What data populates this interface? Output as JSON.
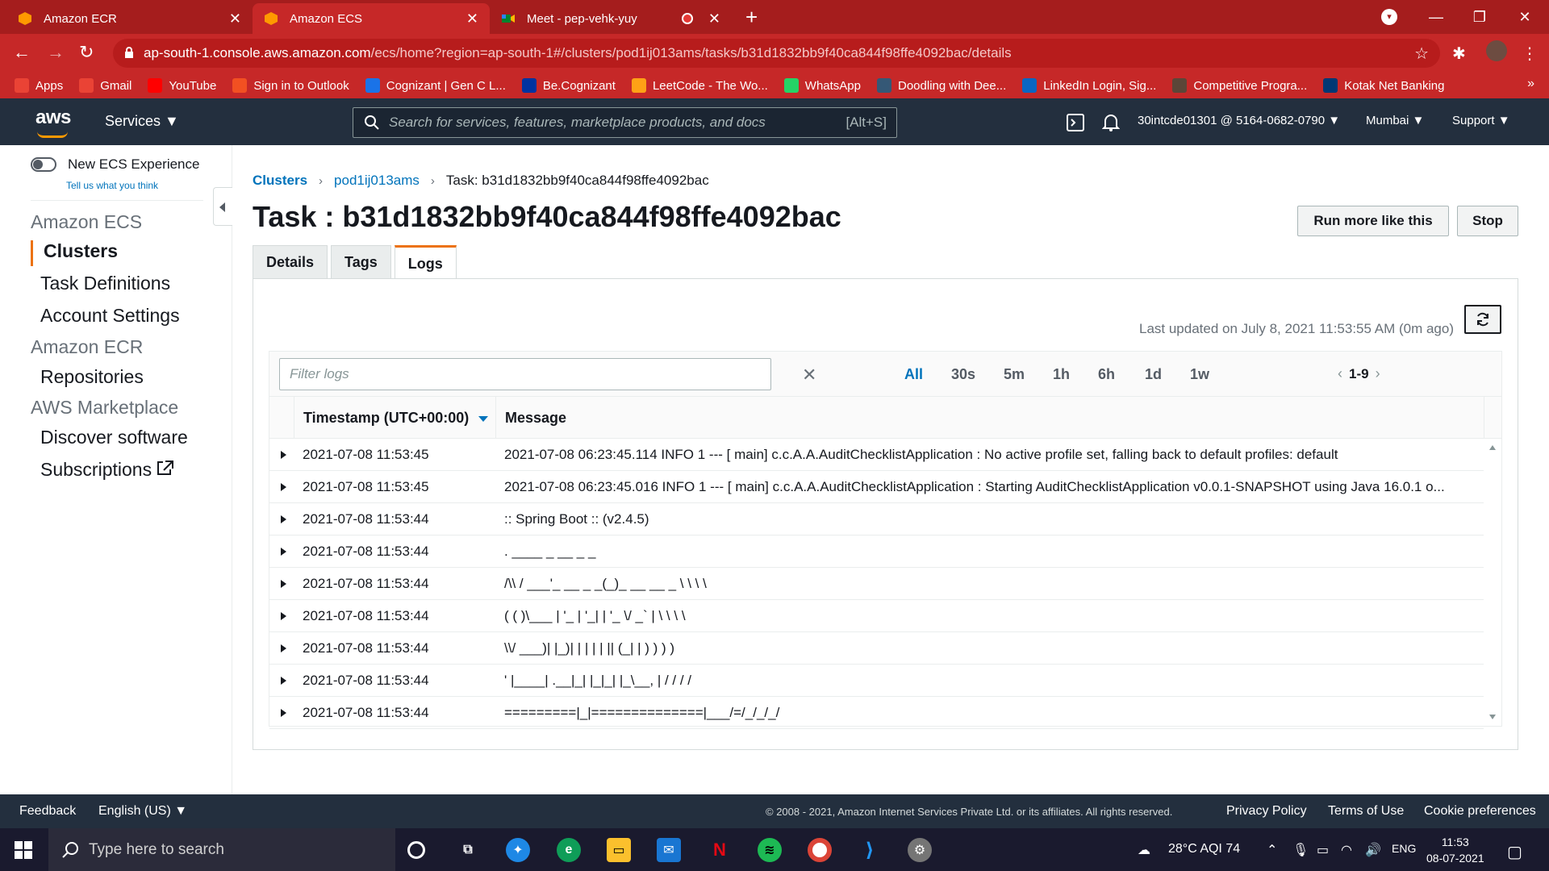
{
  "browser": {
    "tabs": [
      {
        "title": "Amazon ECR",
        "active": false
      },
      {
        "title": "Amazon ECS",
        "active": true
      },
      {
        "title": "Meet - pep-vehk-yuy",
        "active": false
      }
    ],
    "url_host": "ap-south-1.console.aws.amazon.com",
    "url_path": "/ecs/home?region=ap-south-1#/clusters/pod1ij013ams/tasks/b31d1832bb9f40ca844f98ffe4092bac/details",
    "bookmarks": [
      {
        "label": "Apps",
        "icon": "apps-grid-icon",
        "color": "#ea4335"
      },
      {
        "label": "Gmail",
        "icon": "gmail-icon",
        "color": "#ea4335"
      },
      {
        "label": "YouTube",
        "icon": "youtube-icon",
        "color": "#ff0000"
      },
      {
        "label": "Sign in to Outlook",
        "icon": "microsoft-icon",
        "color": "#f25022"
      },
      {
        "label": "Cognizant | Gen C L...",
        "icon": "cognizant-icon",
        "color": "#1a73e8"
      },
      {
        "label": "Be.Cognizant",
        "icon": "becognizant-icon",
        "color": "#0033a0"
      },
      {
        "label": "LeetCode - The Wo...",
        "icon": "leetcode-icon",
        "color": "#ffa116"
      },
      {
        "label": "WhatsApp",
        "icon": "whatsapp-icon",
        "color": "#25d366"
      },
      {
        "label": "Doodling with Dee...",
        "icon": "tds-icon",
        "color": "#355876"
      },
      {
        "label": "LinkedIn Login, Sig...",
        "icon": "linkedin-icon",
        "color": "#0a66c2"
      },
      {
        "label": "Competitive Progra...",
        "icon": "cc-icon",
        "color": "#5b4638"
      },
      {
        "label": "Kotak Net Banking",
        "icon": "kotak-icon",
        "color": "#003874"
      }
    ],
    "bookmarks_more": "»"
  },
  "aws_nav": {
    "logo": "aws",
    "services": "Services",
    "search_placeholder": "Search for services, features, marketplace products, and docs",
    "search_hint": "[Alt+S]",
    "account": "30intcde01301 @ 5164-0682-0790",
    "region": "Mumbai",
    "support": "Support"
  },
  "sidebar": {
    "toggle_label": "New ECS Experience",
    "feedback_link": "Tell us what you think",
    "sections": [
      {
        "heading": "Amazon ECS",
        "items": [
          "Clusters",
          "Task Definitions",
          "Account Settings"
        ]
      },
      {
        "heading": "Amazon ECR",
        "items": [
          "Repositories"
        ]
      },
      {
        "heading": "AWS Marketplace",
        "items": [
          "Discover software",
          "Subscriptions"
        ]
      }
    ],
    "active_item": "Clusters"
  },
  "breadcrumb": {
    "items": [
      "Clusters",
      "pod1ij013ams"
    ],
    "current": "Task: b31d1832bb9f40ca844f98ffe4092bac"
  },
  "page": {
    "title": "Task : b31d1832bb9f40ca844f98ffe4092bac",
    "run_more_label": "Run more like this",
    "stop_label": "Stop",
    "tabs": [
      "Details",
      "Tags",
      "Logs"
    ],
    "active_tab": "Logs"
  },
  "logs": {
    "last_updated": "Last updated on July 8, 2021 11:53:55 AM (0m ago)",
    "filter_placeholder": "Filter logs",
    "ranges": [
      "All",
      "30s",
      "5m",
      "1h",
      "6h",
      "1d",
      "1w"
    ],
    "active_range": "All",
    "pager": "1-9",
    "columns": [
      "Timestamp (UTC+00:00)",
      "Message"
    ],
    "rows": [
      {
        "timestamp": "2021-07-08 11:53:45",
        "message": "2021-07-08 06:23:45.114 INFO 1 --- [ main] c.c.A.A.AuditChecklistApplication : No active profile set, falling back to default profiles: default"
      },
      {
        "timestamp": "2021-07-08 11:53:45",
        "message": "2021-07-08 06:23:45.016 INFO 1 --- [ main] c.c.A.A.AuditChecklistApplication : Starting AuditChecklistApplication v0.0.1-SNAPSHOT using Java 16.0.1 o..."
      },
      {
        "timestamp": "2021-07-08 11:53:44",
        "message": ":: Spring Boot :: (v2.4.5)"
      },
      {
        "timestamp": "2021-07-08 11:53:44",
        "message": ". ____ _ __ _ _"
      },
      {
        "timestamp": "2021-07-08 11:53:44",
        "message": "/\\\\ / ___'_ __ _ _(_)_ __ __ _ \\ \\ \\ \\"
      },
      {
        "timestamp": "2021-07-08 11:53:44",
        "message": "( ( )\\___ | '_ | '_| | '_ \\/ _` | \\ \\ \\ \\"
      },
      {
        "timestamp": "2021-07-08 11:53:44",
        "message": "\\\\/ ___)| |_)| | | | | || (_| | ) ) ) )"
      },
      {
        "timestamp": "2021-07-08 11:53:44",
        "message": "' |____| .__|_| |_|_| |_\\__, | / / / /"
      },
      {
        "timestamp": "2021-07-08 11:53:44",
        "message": "=========|_|==============|___/=/_/_/_/"
      }
    ]
  },
  "footer": {
    "feedback": "Feedback",
    "language": "English (US)",
    "copyright": "© 2008 - 2021, Amazon Internet Services Private Ltd. or its affiliates. All rights reserved.",
    "privacy": "Privacy Policy",
    "terms": "Terms of Use",
    "cookies": "Cookie preferences"
  },
  "taskbar": {
    "search_placeholder": "Type here to search",
    "weather": "28°C AQI 74",
    "lang": "ENG",
    "time": "11:53",
    "date": "08-07-2021"
  },
  "colors": {
    "chrome_tab_bar": "#a51d1d",
    "chrome_toolbar": "#c62828",
    "aws_nav": "#232f3e",
    "aws_orange": "#ec7211",
    "link_blue": "#0073bb"
  }
}
